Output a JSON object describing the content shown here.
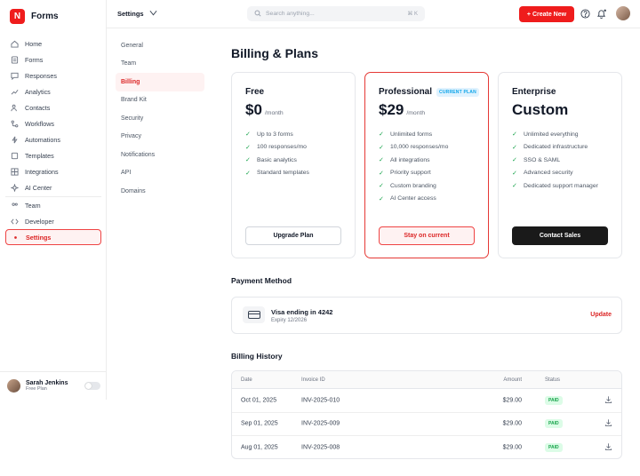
{
  "brand": {
    "logo_letter": "N",
    "name": "Forms",
    "color": "#ef1c1c"
  },
  "sidebar": {
    "items": [
      {
        "label": "Home",
        "icon": "home-icon"
      },
      {
        "label": "Forms",
        "icon": "document-icon"
      },
      {
        "label": "Responses",
        "icon": "chat-icon"
      },
      {
        "label": "Analytics",
        "icon": "chart-icon"
      },
      {
        "label": "Contacts",
        "icon": "users-icon"
      },
      {
        "label": "Workflows",
        "icon": "workflow-icon"
      },
      {
        "label": "Automations",
        "icon": "automation-icon"
      },
      {
        "label": "Templates",
        "icon": "template-icon"
      },
      {
        "label": "Integrations",
        "icon": "grid-icon"
      },
      {
        "label": "AI Center",
        "icon": "sparkle-icon"
      },
      {
        "label": "Team",
        "icon": "team-icon"
      },
      {
        "label": "Developer",
        "icon": "code-icon"
      },
      {
        "label": "Settings",
        "icon": "settings-icon",
        "active": true
      }
    ]
  },
  "user": {
    "name": "Sarah Jenkins",
    "plan": "Free Plan"
  },
  "header": {
    "breadcrumb": "Settings",
    "search_placeholder": "Search anything...",
    "search_shortcut": "⌘ K",
    "create_button": "+ Create New"
  },
  "subnav": {
    "items": [
      "General",
      "Team",
      "Billing",
      "Brand Kit",
      "Security",
      "Privacy",
      "Notifications",
      "API",
      "Domains"
    ],
    "active": "Billing"
  },
  "page": {
    "title": "Billing & Plans"
  },
  "plans": [
    {
      "name": "Free",
      "price": "$0",
      "period": "/month",
      "features": [
        "Up to 3 forms",
        "100 responses/mo",
        "Basic analytics",
        "Standard templates"
      ],
      "button": "Upgrade Plan",
      "current": false
    },
    {
      "name": "Professional",
      "badge": "CURRENT PLAN",
      "price": "$29",
      "period": "/month",
      "features": [
        "Unlimited forms",
        "10,000 responses/mo",
        "All integrations",
        "Priority support",
        "Custom branding",
        "AI Center access"
      ],
      "button": "Stay on current",
      "current": true
    },
    {
      "name": "Enterprise",
      "price": "Custom",
      "period": "",
      "features": [
        "Unlimited everything",
        "Dedicated infrastructure",
        "SSO & SAML",
        "Advanced security",
        "Dedicated support manager"
      ],
      "button": "Contact Sales",
      "current": false
    }
  ],
  "payment": {
    "section_title": "Payment Method",
    "card_title": "Visa ending in 4242",
    "expiry": "Expiry 12/2026",
    "update_label": "Update"
  },
  "billing_history": {
    "section_title": "Billing History",
    "columns": [
      "Date",
      "Invoice ID",
      "Amount",
      "Status"
    ],
    "rows": [
      {
        "date": "Oct 01, 2025",
        "invoice": "INV-2025-010",
        "amount": "$29.00",
        "status": "PAID"
      },
      {
        "date": "Sep 01, 2025",
        "invoice": "INV-2025-009",
        "amount": "$29.00",
        "status": "PAID"
      },
      {
        "date": "Aug 01, 2025",
        "invoice": "INV-2025-008",
        "amount": "$29.00",
        "status": "PAID"
      }
    ]
  }
}
